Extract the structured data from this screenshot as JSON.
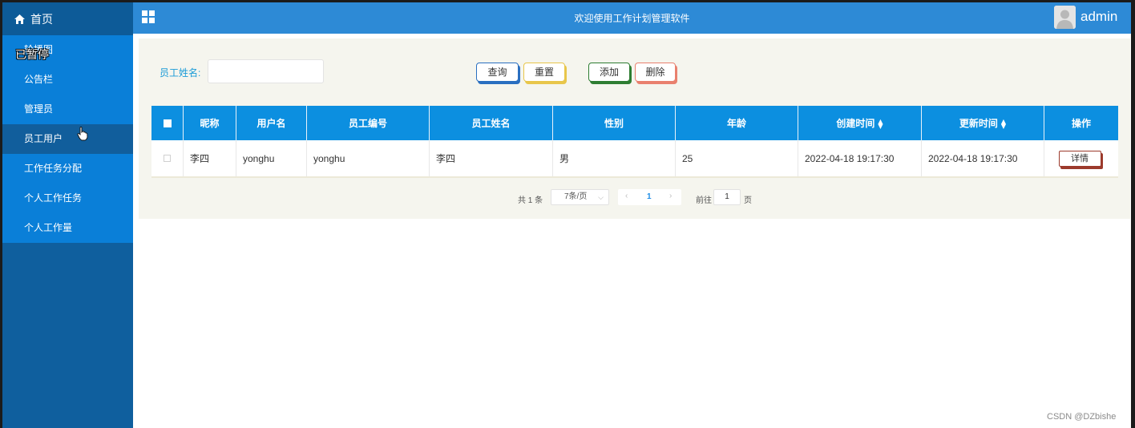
{
  "sidebar": {
    "home_label": "首页",
    "overlay_text": "已暂停",
    "items": [
      {
        "label": "轮播图"
      },
      {
        "label": "公告栏"
      },
      {
        "label": "管理员"
      },
      {
        "label": "员工用户"
      },
      {
        "label": "工作任务分配"
      },
      {
        "label": "个人工作任务"
      },
      {
        "label": "个人工作量"
      }
    ],
    "active_item": "员工用户",
    "colors": {
      "sidebar_bg": "#0f5f9e",
      "item_bg": "#0a7fd8",
      "active_bg": "#115e9c"
    }
  },
  "header": {
    "title": "欢迎使用工作计划管理软件",
    "user": "admin",
    "colors": {
      "bar_bg": "#2d8ad6"
    }
  },
  "search": {
    "label": "员工姓名:",
    "value": "",
    "placeholder": ""
  },
  "toolbar": {
    "query_label": "查询",
    "reset_label": "重置",
    "add_label": "添加",
    "delete_label": "删除"
  },
  "table": {
    "headers": {
      "nickname": "昵称",
      "username": "用户名",
      "emp_no": "员工编号",
      "emp_name": "员工姓名",
      "gender": "性别",
      "age": "年龄",
      "created": "创建时间",
      "updated": "更新时间",
      "actions": "操作"
    },
    "rows": [
      {
        "nickname": "李四",
        "username": "yonghu",
        "emp_no": "yonghu",
        "emp_name": "李四",
        "gender": "男",
        "age": "25",
        "created": "2022-04-18 19:17:30",
        "updated": "2022-04-18 19:17:30",
        "action_label": "详情"
      }
    ],
    "colors": {
      "header_bg": "#0c8fe0"
    }
  },
  "pagination": {
    "total_text": "共 1 条",
    "page_size": "7条/页",
    "current_page": "1",
    "goto_label": "前往",
    "goto_value": "1",
    "goto_suffix": "页"
  },
  "watermark": "CSDN @DZbishe"
}
